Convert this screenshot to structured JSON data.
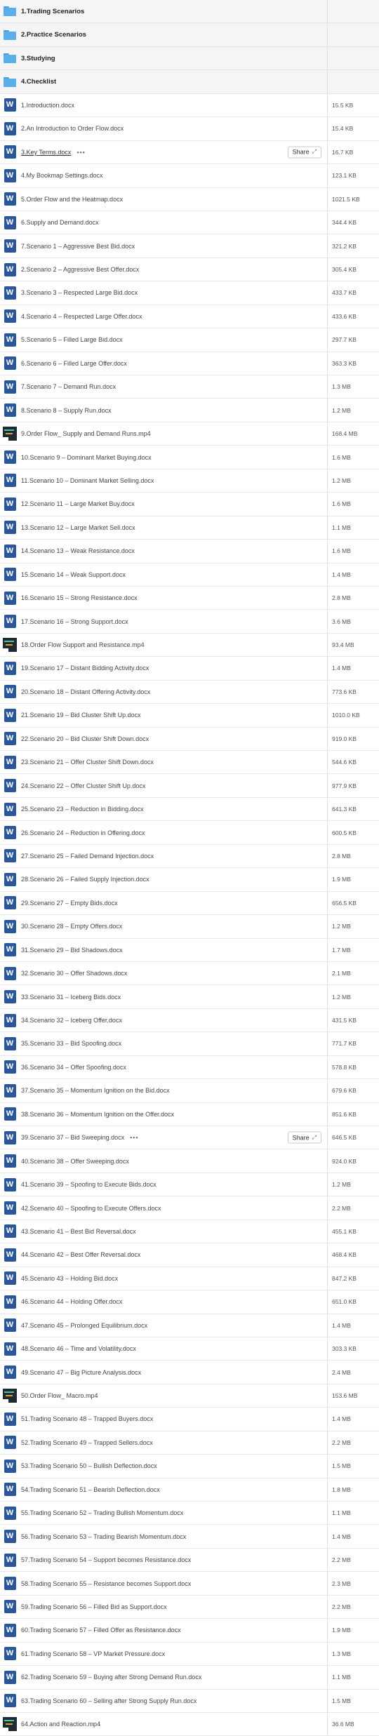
{
  "folders": [
    {
      "label": "1.Trading Scenarios"
    },
    {
      "label": "2.Practice Scenarios"
    },
    {
      "label": "3.Studying"
    },
    {
      "label": "4.Checklist"
    }
  ],
  "share_label": "Share",
  "files": [
    {
      "type": "word",
      "name": "1.Introduction.docx",
      "size": "15.5 KB"
    },
    {
      "type": "word",
      "name": "2.An Introduction to Order Flow.docx",
      "size": "15.4 KB"
    },
    {
      "type": "word",
      "name": "3.Key Terms.docx",
      "size": "16.7 KB",
      "hover": true
    },
    {
      "type": "word",
      "name": "4.My Bookmap Settings.docx",
      "size": "123.1 KB"
    },
    {
      "type": "word",
      "name": "5.Order Flow and the Heatmap.docx",
      "size": "1021.5 KB"
    },
    {
      "type": "word",
      "name": "6.Supply and Demand.docx",
      "size": "344.4 KB"
    },
    {
      "type": "word",
      "name": "7.Scenario 1 – Aggressive Best Bid.docx",
      "size": "321.2 KB"
    },
    {
      "type": "word",
      "name": "2.Scenario 2 – Aggressive Best Offer.docx",
      "size": "305.4 KB"
    },
    {
      "type": "word",
      "name": "3.Scenario 3 – Respected Large Bid.docx",
      "size": "433.7 KB"
    },
    {
      "type": "word",
      "name": "4.Scenario 4 – Respected Large Offer.docx",
      "size": "433.6 KB"
    },
    {
      "type": "word",
      "name": "5.Scenario 5 – Filled Large Bid.docx",
      "size": "297.7 KB"
    },
    {
      "type": "word",
      "name": "6.Scenario 6 – Filled Large Offer.docx",
      "size": "363.3 KB"
    },
    {
      "type": "word",
      "name": "7.Scenario 7 – Demand Run.docx",
      "size": "1.3 MB"
    },
    {
      "type": "word",
      "name": "8.Scenario 8 – Supply Run.docx",
      "size": "1.2 MB"
    },
    {
      "type": "video",
      "name": "9.Order Flow_ Supply and Demand Runs.mp4",
      "size": "168.4 MB"
    },
    {
      "type": "word",
      "name": "10.Scenario 9 – Dominant Market Buying.docx",
      "size": "1.6 MB"
    },
    {
      "type": "word",
      "name": "11.Scenario 10 – Dominant Market Selling.docx",
      "size": "1.2 MB"
    },
    {
      "type": "word",
      "name": "12.Scenario 11 – Large Market Buy.docx",
      "size": "1.6 MB"
    },
    {
      "type": "word",
      "name": "13.Scenario 12 – Large Market Sell.docx",
      "size": "1.1 MB"
    },
    {
      "type": "word",
      "name": "14.Scenario 13 – Weak Resistance.docx",
      "size": "1.6 MB"
    },
    {
      "type": "word",
      "name": "15.Scenario 14 – Weak Support.docx",
      "size": "1.4 MB"
    },
    {
      "type": "word",
      "name": "16.Scenario 15 – Strong Resistance.docx",
      "size": "2.8 MB"
    },
    {
      "type": "word",
      "name": "17.Scenario 16 – Strong Support.docx",
      "size": "3.6 MB"
    },
    {
      "type": "video",
      "name": "18.Order Flow Support and Resistance.mp4",
      "size": "93.4 MB"
    },
    {
      "type": "word",
      "name": "19.Scenario 17 – Distant Bidding Activity.docx",
      "size": "1.4 MB"
    },
    {
      "type": "word",
      "name": "20.Scenario 18 – Distant Offering Activity.docx",
      "size": "773.6 KB"
    },
    {
      "type": "word",
      "name": "21.Scenario 19 – Bid Cluster Shift Up.docx",
      "size": "1010.0 KB"
    },
    {
      "type": "word",
      "name": "22.Scenario 20 – Bid Cluster Shift Down.docx",
      "size": "919.0 KB"
    },
    {
      "type": "word",
      "name": "23.Scenario 21 – Offer Cluster Shift Down.docx",
      "size": "544.6 KB"
    },
    {
      "type": "word",
      "name": "24.Scenario 22 – Offer Cluster Shift Up.docx",
      "size": "977.9 KB"
    },
    {
      "type": "word",
      "name": "25.Scenario 23 – Reduction in Bidding.docx",
      "size": "641.3 KB"
    },
    {
      "type": "word",
      "name": "26.Scenario 24 – Reduction in Offering.docx",
      "size": "600.5 KB"
    },
    {
      "type": "word",
      "name": "27.Scenario 25 – Failed Demand Injection.docx",
      "size": "2.8 MB"
    },
    {
      "type": "word",
      "name": "28.Scenario 26 – Failed Supply Injection.docx",
      "size": "1.9 MB"
    },
    {
      "type": "word",
      "name": "29.Scenario 27 – Empty Bids.docx",
      "size": "656.5 KB"
    },
    {
      "type": "word",
      "name": "30.Scenario 28 – Empty Offers.docx",
      "size": "1.2 MB"
    },
    {
      "type": "word",
      "name": "31.Scenario 29 – Bid Shadows.docx",
      "size": "1.7 MB"
    },
    {
      "type": "word",
      "name": "32.Scenario 30 – Offer Shadows.docx",
      "size": "2.1 MB"
    },
    {
      "type": "word",
      "name": "33.Scenario 31 – Iceberg Bids.docx",
      "size": "1.2 MB"
    },
    {
      "type": "word",
      "name": "34.Scenario 32 – Iceberg Offer.docx",
      "size": "431.5 KB"
    },
    {
      "type": "word",
      "name": "35.Scenario 33 – Bid Spoofing.docx",
      "size": "771.7 KB"
    },
    {
      "type": "word",
      "name": "36.Scenario 34 – Offer Spoofing.docx",
      "size": "578.8 KB"
    },
    {
      "type": "word",
      "name": "37.Scenario 35 – Momentum Ignition on the Bid.docx",
      "size": "679.6 KB"
    },
    {
      "type": "word",
      "name": "38.Scenario 36 – Momentum Ignition on the Offer.docx",
      "size": "851.6 KB"
    },
    {
      "type": "word",
      "name": "39.Scenario 37 – Bid Sweeping.docx",
      "size": "646.5 KB",
      "hover": true
    },
    {
      "type": "word",
      "name": "40.Scenario 38 – Offer Sweeping.docx",
      "size": "924.0 KB"
    },
    {
      "type": "word",
      "name": "41.Scenario 39 – Spoofing to Execute Bids.docx",
      "size": "1.2 MB"
    },
    {
      "type": "word",
      "name": "42.Scenario 40 – Spoofing to Execute Offers.docx",
      "size": "2.2 MB"
    },
    {
      "type": "word",
      "name": "43.Scenario 41 – Best Bid Reversal.docx",
      "size": "455.1 KB"
    },
    {
      "type": "word",
      "name": "44.Scenario 42 – Best Offer Reversal.docx",
      "size": "468.4 KB"
    },
    {
      "type": "word",
      "name": "45.Scenario 43 – Holding Bid.docx",
      "size": "847.2 KB"
    },
    {
      "type": "word",
      "name": "46.Scenario 44 – Holding Offer.docx",
      "size": "651.0 KB"
    },
    {
      "type": "word",
      "name": "47.Scenario 45 – Prolonged Equilibrium.docx",
      "size": "1.4 MB"
    },
    {
      "type": "word",
      "name": "48.Scenario 46 – Time and Volatility.docx",
      "size": "303.3 KB"
    },
    {
      "type": "word",
      "name": "49.Scenario 47 – Big Picture Analysis.docx",
      "size": "2.4 MB"
    },
    {
      "type": "video",
      "name": "50.Order Flow_ Macro.mp4",
      "size": "153.6 MB"
    },
    {
      "type": "word",
      "name": "51.Trading Scenario 48 – Trapped Buyers.docx",
      "size": "1.4 MB"
    },
    {
      "type": "word",
      "name": "52.Trading Scenario 49 – Trapped Sellers.docx",
      "size": "2.2 MB"
    },
    {
      "type": "word",
      "name": "53.Trading Scenario 50 – Bullish Deflection.docx",
      "size": "1.5 MB"
    },
    {
      "type": "word",
      "name": "54.Trading Scenario 51 – Bearish Deflection.docx",
      "size": "1.8 MB"
    },
    {
      "type": "word",
      "name": "55.Trading Scenario 52 – Trading Bullish Momentum.docx",
      "size": "1.1 MB"
    },
    {
      "type": "word",
      "name": "56.Trading Scenario 53 – Trading Bearish Momentum.docx",
      "size": "1.4 MB"
    },
    {
      "type": "word",
      "name": "57.Trading Scenario 54 – Support becomes Resistance.docx",
      "size": "2.2 MB"
    },
    {
      "type": "word",
      "name": "58.Trading Scenario 55 – Resistance becomes Support.docx",
      "size": "2.3 MB"
    },
    {
      "type": "word",
      "name": "59.Trading Scenario 56 – Filled Bid as Support.docx",
      "size": "2.2 MB"
    },
    {
      "type": "word",
      "name": "60.Trading Scenario 57 – Filled Offer as Resistance.docx",
      "size": "1.9 MB"
    },
    {
      "type": "word",
      "name": "61.Trading Scenario 58 – VP Market Pressure.docx",
      "size": "1.3 MB"
    },
    {
      "type": "word",
      "name": "62.Trading Scenario 59 – Buying after Strong Demand Run.docx",
      "size": "1.1 MB"
    },
    {
      "type": "word",
      "name": "63.Trading Scenario 60 – Selling after Strong Supply Run.docx",
      "size": "1.5 MB"
    },
    {
      "type": "video",
      "name": "64.Action and Reaction.mp4",
      "size": "36.6 MB"
    }
  ]
}
